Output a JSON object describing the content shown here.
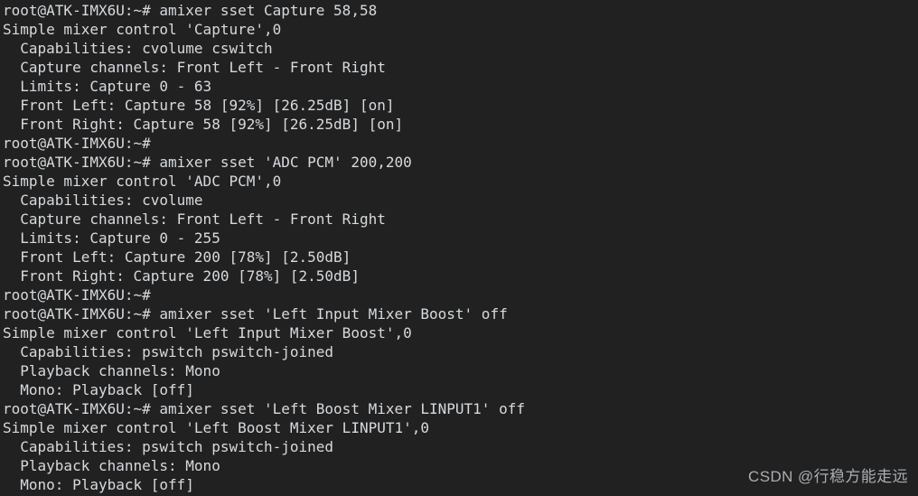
{
  "terminal": {
    "background_color": "#212121",
    "text_color": "#d6dade",
    "hostname_prompt": "root@ATK-IMX6U:~#",
    "lines": [
      "root@ATK-IMX6U:~# amixer sset Capture 58,58",
      "Simple mixer control 'Capture',0",
      "  Capabilities: cvolume cswitch",
      "  Capture channels: Front Left - Front Right",
      "  Limits: Capture 0 - 63",
      "  Front Left: Capture 58 [92%] [26.25dB] [on]",
      "  Front Right: Capture 58 [92%] [26.25dB] [on]",
      "root@ATK-IMX6U:~#",
      "root@ATK-IMX6U:~# amixer sset 'ADC PCM' 200,200",
      "Simple mixer control 'ADC PCM',0",
      "  Capabilities: cvolume",
      "  Capture channels: Front Left - Front Right",
      "  Limits: Capture 0 - 255",
      "  Front Left: Capture 200 [78%] [2.50dB]",
      "  Front Right: Capture 200 [78%] [2.50dB]",
      "root@ATK-IMX6U:~#",
      "root@ATK-IMX6U:~# amixer sset 'Left Input Mixer Boost' off",
      "Simple mixer control 'Left Input Mixer Boost',0",
      "  Capabilities: pswitch pswitch-joined",
      "  Playback channels: Mono",
      "  Mono: Playback [off]",
      "root@ATK-IMX6U:~# amixer sset 'Left Boost Mixer LINPUT1' off",
      "Simple mixer control 'Left Boost Mixer LINPUT1',0",
      "  Capabilities: pswitch pswitch-joined",
      "  Playback channels: Mono",
      "  Mono: Playback [off]"
    ]
  },
  "watermark": {
    "text": "CSDN @行稳方能走远",
    "color": "#a9aeb2"
  }
}
